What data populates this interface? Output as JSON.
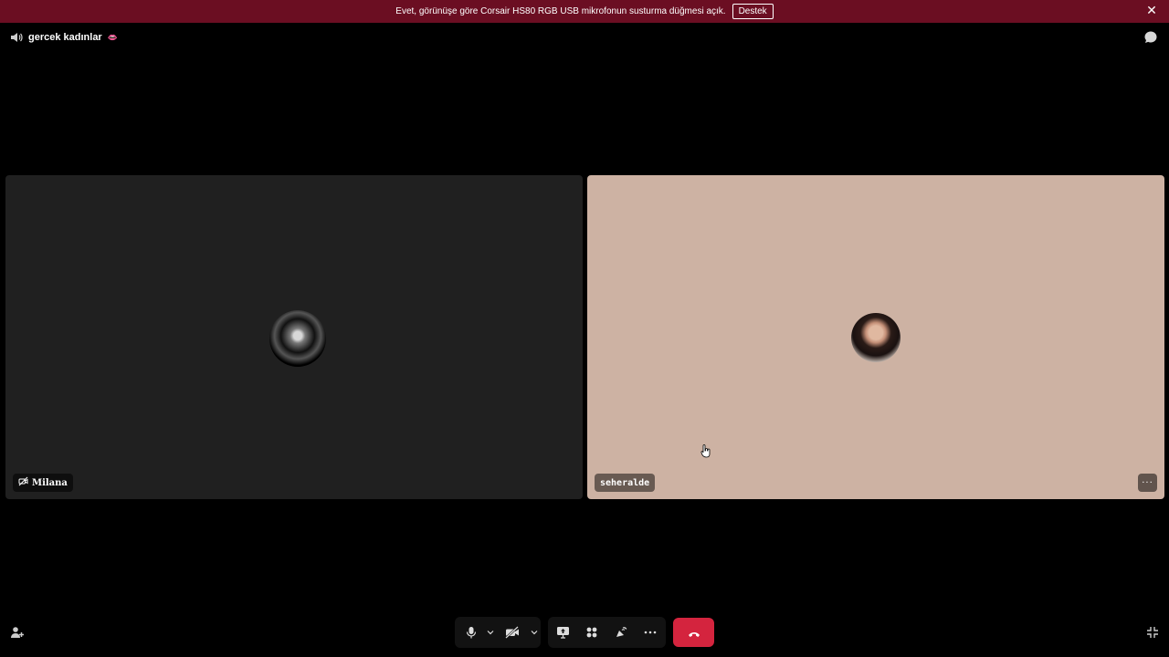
{
  "banner": {
    "message": "Evet, görünüşe göre Corsair HS80 RGB USB mikrofonun susturma düğmesi açık.",
    "button_label": "Destek",
    "close_symbol": "✕",
    "background": "#6b0e22"
  },
  "channel": {
    "name": "gercek kadınlar",
    "icon": "speaker-icon",
    "emoji": "👄"
  },
  "participants": [
    {
      "name": "Milana",
      "name_icon": "camera-off-icon",
      "tile_color": "#202020"
    },
    {
      "name": "seheralde",
      "tile_color": "#cdb2a3",
      "more_symbol": "···"
    }
  ],
  "controls": {
    "icons": [
      "microphone-icon",
      "chevron-down-icon",
      "camera-off-icon",
      "chevron-down-icon",
      "screen-share-icon",
      "activities-icon",
      "soundboard-icon",
      "more-icon",
      "hang-up-icon"
    ],
    "hangup_color": "#d4243e"
  }
}
